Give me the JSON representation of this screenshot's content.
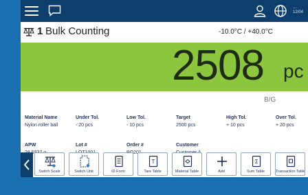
{
  "topbar": {
    "clock_line1": "...",
    "clock_line2": "12/04"
  },
  "title": {
    "scale_number": "1",
    "name": "Bulk Counting",
    "temp_range": "-10.0°C / +40.0°C"
  },
  "weight": {
    "value": "2508",
    "unit": "pc",
    "mode": "B/G",
    "panel_color": "#8cc63f"
  },
  "details_row1": [
    {
      "label": "Material Name",
      "value": "Nylon roller ball"
    },
    {
      "label": "Under Tol.",
      "value": "- 20 pcs"
    },
    {
      "label": "Low Tol.",
      "value": "- 10 pcs"
    },
    {
      "label": "Target",
      "value": "2500 pcs"
    },
    {
      "label": "High Tol.",
      "value": "+ 10 pcs"
    },
    {
      "label": "Over Tol.",
      "value": "+ 20 pcs"
    }
  ],
  "details_row2": [
    {
      "label": "APW",
      "value": "28.6937 g"
    },
    {
      "label": "Lot #",
      "value": "LOT1001"
    },
    {
      "label": "Order #",
      "value": "PO201"
    },
    {
      "label": "Customer",
      "value": "Customer A"
    }
  ],
  "softkeys": [
    {
      "label": "Switch Scale",
      "icon": "scale-icon"
    },
    {
      "label": "Switch Unit",
      "icon": "unit-icon"
    },
    {
      "label": "ID Form",
      "icon": "form-icon"
    },
    {
      "label": "Tare Table",
      "icon": "tare-table-icon"
    },
    {
      "label": "Material Table",
      "icon": "material-table-icon"
    },
    {
      "label": "Add",
      "icon": "plus-icon"
    },
    {
      "label": "Sum Table",
      "icon": "sum-table-icon"
    },
    {
      "label": "Transaction Table",
      "icon": "transaction-table-icon"
    }
  ],
  "colors": {
    "topbar": "#0d3e6c",
    "text_dark": "#1b2d5a",
    "background": "#1a6fb0"
  }
}
